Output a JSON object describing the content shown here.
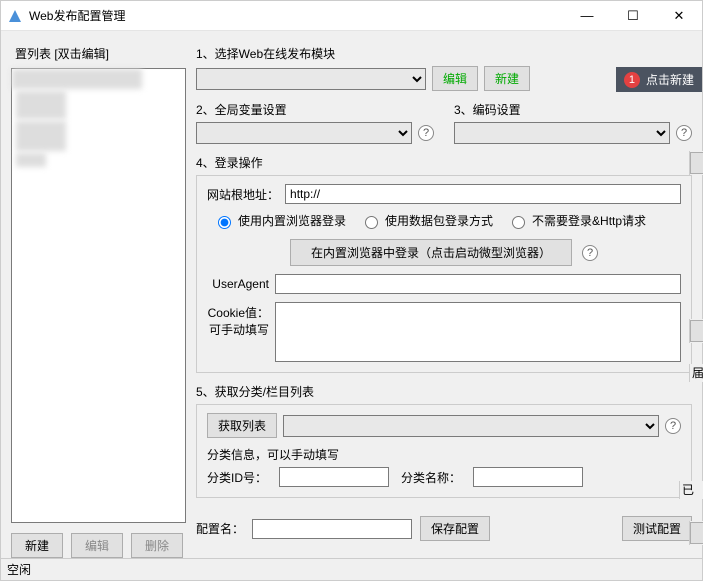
{
  "window": {
    "title": "Web发布配置管理",
    "minimize": "—",
    "maximize": "☐",
    "close": "✕"
  },
  "left": {
    "label": "置列表  [双击编辑]",
    "buttons": {
      "new": "新建",
      "edit": "编辑",
      "delete": "删除"
    }
  },
  "s1": {
    "label": "1、选择Web在线发布模块",
    "edit": "编辑",
    "new": "新建"
  },
  "s2": {
    "label": "2、全局变量设置"
  },
  "s3": {
    "label": "3、编码设置"
  },
  "s4": {
    "label": "4、登录操作",
    "url_label": "网站根地址：",
    "url_value": "http://",
    "r1": "使用内置浏览器登录",
    "r2": "使用数据包登录方式",
    "r3": "不需要登录&Http请求",
    "login_btn": "在内置浏览器中登录（点击启动微型浏览器）",
    "ua_label": "UserAgent",
    "cookie_label": "Cookie值：可手动填写"
  },
  "s5": {
    "label": "5、获取分类/栏目列表",
    "get_btn": "获取列表",
    "info_label": "分类信息，可以手动填写",
    "id_label": "分类ID号：",
    "name_label": "分类名称："
  },
  "footer": {
    "config_name_label": "配置名：",
    "save": "保存配置",
    "test": "测试配置"
  },
  "status": "空闲",
  "tooltip": {
    "badge": "1",
    "text": "点击新建"
  },
  "outside": {
    "label1": "届",
    "label2": "已发"
  },
  "help": "?"
}
